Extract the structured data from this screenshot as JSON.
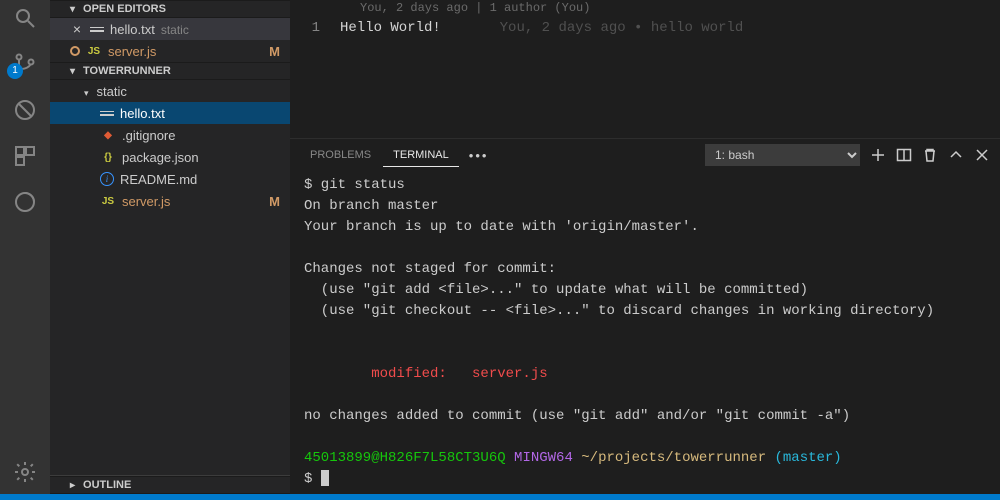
{
  "activity": {
    "scm_badge": "1"
  },
  "sidebar": {
    "openEditorsHeader": "OPEN EDITORS",
    "projectHeader": "TOWERRUNNER",
    "outlineHeader": "OUTLINE",
    "openEditors": [
      {
        "name": "hello.txt",
        "desc": "static",
        "close": "×"
      },
      {
        "name": "server.js",
        "modified": "M"
      }
    ],
    "staticFolder": "static",
    "files": {
      "hello": "hello.txt",
      "gitignore": ".gitignore",
      "package": "package.json",
      "readme": "README.md",
      "server": "server.js",
      "serverMod": "M"
    }
  },
  "editor": {
    "blame": "You, 2 days ago | 1 author (You)",
    "lineNum": "1",
    "content": "Hello World!",
    "ghost": "       You, 2 days ago • hello world"
  },
  "panel": {
    "tabs": {
      "problems": "PROBLEMS",
      "terminal": "TERMINAL"
    },
    "ellipsis": "•••",
    "select": "1: bash"
  },
  "terminal": {
    "l1": "$ git status",
    "l2": "On branch master",
    "l3": "Your branch is up to date with 'origin/master'.",
    "l4": "",
    "l5": "Changes not staged for commit:",
    "l6": "  (use \"git add <file>...\" to update what will be committed)",
    "l7": "  (use \"git checkout -- <file>...\" to discard changes in working directory)",
    "l8": "",
    "l9": "",
    "mod": "        modified:   server.js",
    "l10": "",
    "l11": "no changes added to commit (use \"git add\" and/or \"git commit -a\")",
    "l12": "",
    "promptUser": "45013899@H826F7L58CT3U6Q",
    "promptSys": " MINGW64",
    "promptPath": " ~/projects/towerrunner",
    "promptBranch": " (master)",
    "prompt2": "$ "
  }
}
